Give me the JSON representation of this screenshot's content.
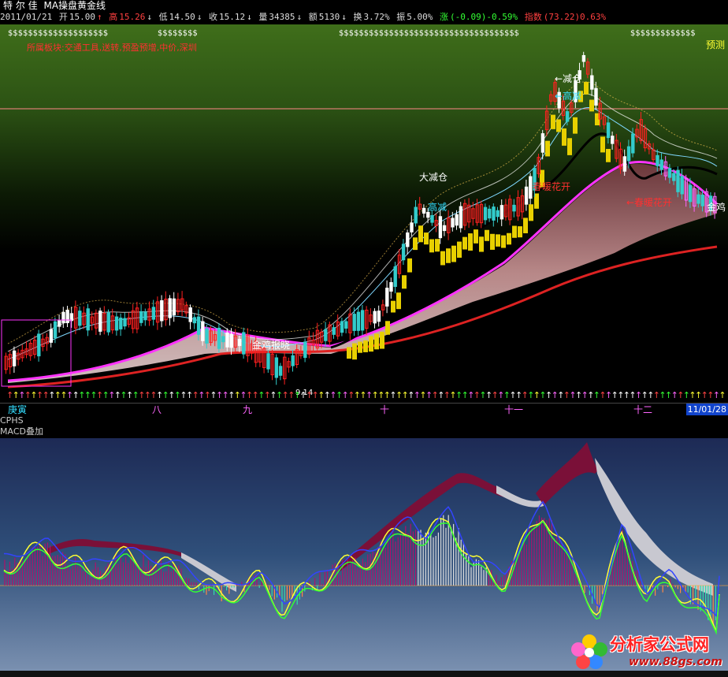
{
  "header": {
    "stock_name": "特 尔 佳",
    "indicator_title": "MA操盘黄金线"
  },
  "quote": {
    "date": "2011/01/21",
    "open_label": "开",
    "open": "15.00",
    "high_label": "高",
    "high": "15.26",
    "low_label": "低",
    "low": "14.50",
    "close_label": "收",
    "close": "15.12",
    "volume_label": "量",
    "volume": "34385",
    "amount_label": "额",
    "amount": "5130",
    "turnover_label": "换",
    "turnover": "3.72%",
    "amplitude_label": "振",
    "amplitude": "5.00%",
    "change_label": "涨",
    "change": "(-0.09)-0.59%",
    "index_label": "指数",
    "index": "(73.22)0.63%"
  },
  "main": {
    "dollar_row_segments": [
      "$$$$$$$$$$$$$$$$$$$$",
      "$$$$$$$$",
      "$$$$$$$$$$$$$$$$$$$$$$$$$$$$$$$$$$$$",
      "$$$$$$$$$$$$$"
    ],
    "sector_text": "所属板块:交通工具,送转,预盈预增,中价,深圳",
    "forecast_label": "预测",
    "annotations": {
      "big_reduce": "大减仓",
      "high_reduce_1": "高减",
      "reduce": "←减仓",
      "high_reduce_2": "←高减",
      "spring_flowers_1": "春暖花开",
      "spring_flowers_2": "←春暖花开",
      "golden_rooster_1": "金鸡报晓",
      "golden_rooster_2": "金鸡",
      "bottom_date": "9.14"
    },
    "colors": {
      "background_top": "#3f6e1a",
      "background_bottom": "#000000",
      "ma_red": "#dd2222",
      "ma_magenta": "#ff33ff",
      "ribbon": "#c88a8a",
      "candle_up": "#ff2020",
      "candle_down": "#ffffff",
      "yellow_steps": "#e8d000"
    }
  },
  "axis": {
    "months": [
      "庚寅",
      "八",
      "九",
      "十",
      "十一",
      "十二"
    ],
    "end_date": "11/01/28"
  },
  "cphs_label": "CPHS",
  "macd": {
    "label": "MACD叠加",
    "colors": {
      "background_top": "#1d2a55",
      "background_bottom": "#6a84a8",
      "band_wine": "#7a1038",
      "band_silver": "#c8c8d0",
      "line_yellow": "#ffff33",
      "line_green": "#33ff33",
      "line_blue": "#3344ff"
    }
  },
  "watermark": {
    "brand": "分析家公式网",
    "url": "www.88gs.com"
  }
}
